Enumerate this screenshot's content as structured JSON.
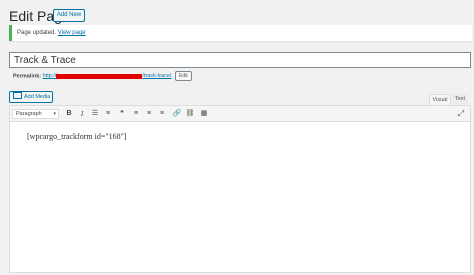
{
  "header": {
    "title": "Edit Page",
    "add_new_label": "Add New"
  },
  "notice": {
    "text": "Page updated.",
    "link_text": "View page",
    "accent": "#46b450"
  },
  "post": {
    "title": "Track & Trace"
  },
  "permalink": {
    "label": "Permalink:",
    "url_start": "http://",
    "url_end": "/track-trace/",
    "edit_label": "Edit"
  },
  "editor": {
    "add_media_label": "Add Media",
    "tabs": {
      "visual": "Visual",
      "text": "Text"
    },
    "format_select": "Paragraph",
    "toolbar": {
      "bold": "B",
      "italic": "I",
      "bullet_list": "☰",
      "numbered_list": "≡",
      "blockquote": "❝",
      "align_left": "≡",
      "align_center": "≡",
      "align_right": "≡",
      "link": "🔗",
      "unlink": "⛓",
      "toolbar_toggle": "▦"
    },
    "content": "[wpcargo_trackform id=\"168\"]"
  }
}
